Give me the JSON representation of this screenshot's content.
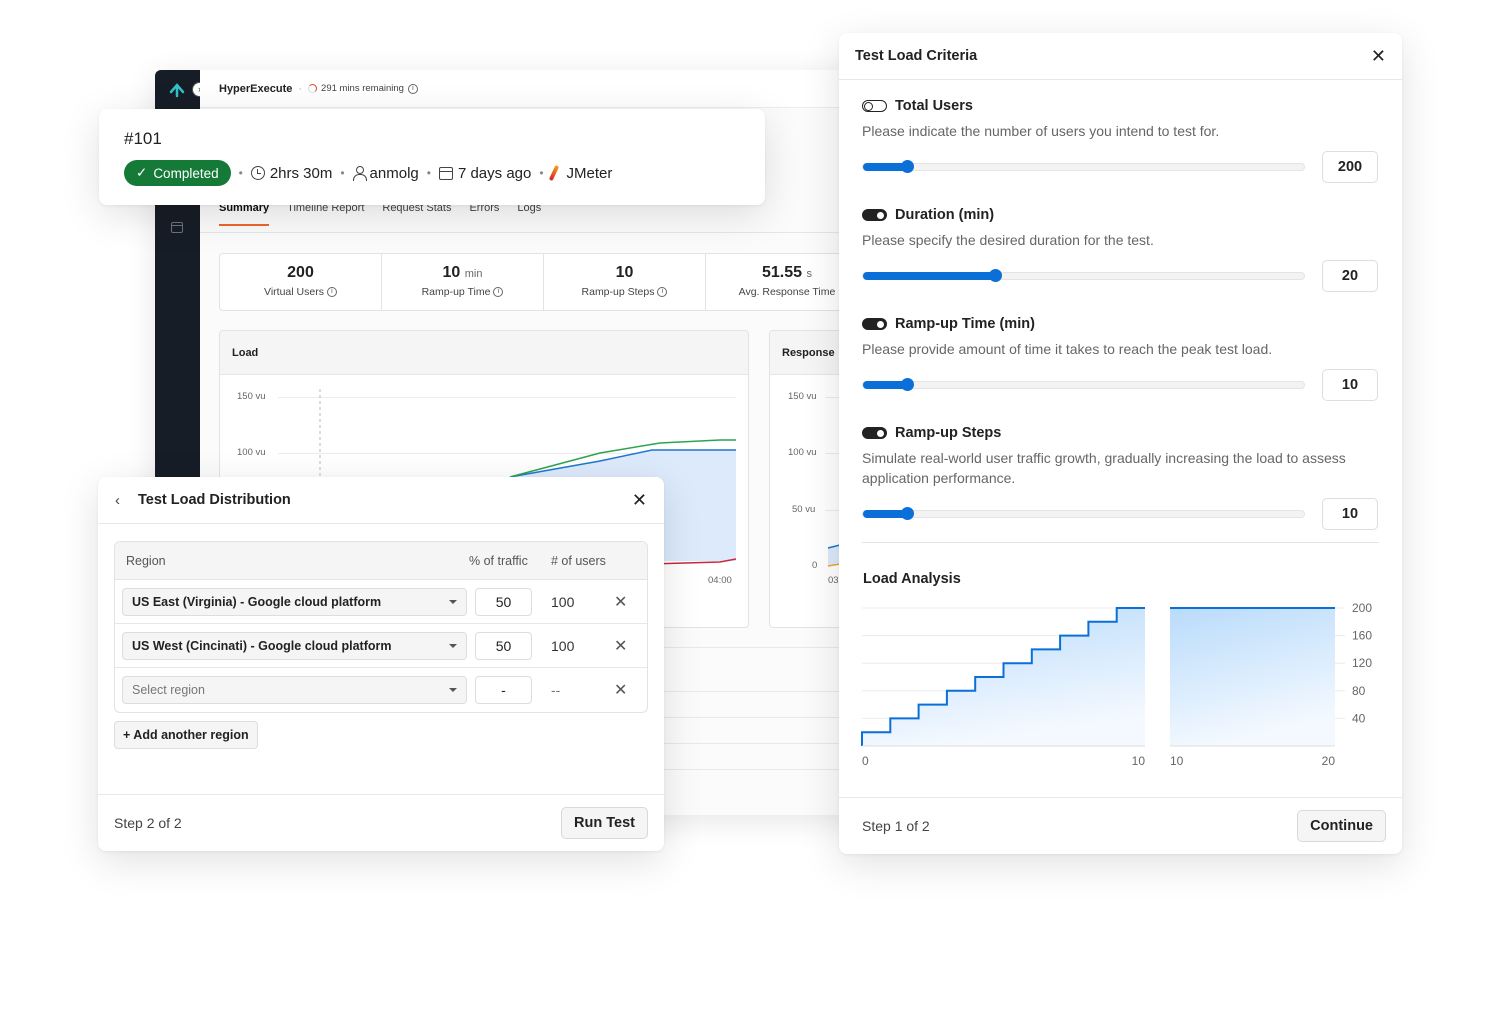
{
  "app": {
    "product": "HyperExecute",
    "separator": "·",
    "remaining": "291 mins remaining",
    "tabs": [
      {
        "label": "Summary",
        "active": true
      },
      {
        "label": "Timeline Report",
        "active": false
      },
      {
        "label": "Request Stats",
        "active": false
      },
      {
        "label": "Errors",
        "active": false
      },
      {
        "label": "Logs",
        "active": false
      }
    ],
    "stats": [
      {
        "value": "200",
        "unit": "",
        "label": "Virtual Users"
      },
      {
        "value": "10",
        "unit": "min",
        "label": "Ramp-up Time"
      },
      {
        "value": "10",
        "unit": "",
        "label": "Ramp-up Steps"
      },
      {
        "value": "51.55",
        "unit": "s",
        "label": "Avg. Response Time"
      }
    ],
    "load_chart": {
      "title": "Load",
      "yticks": [
        "150 vu",
        "100 vu"
      ],
      "x_tick_visible": "04:00",
      "series_colors": {
        "total": "#2ea44f",
        "active": "#1f77d0",
        "errors": "#c62a3c"
      }
    },
    "response_chart": {
      "title": "Response",
      "yticks": [
        "150 vu",
        "100 vu",
        "50 vu",
        "0"
      ],
      "x_tick_visible": "03"
    }
  },
  "job": {
    "id": "#101",
    "status": "Completed",
    "duration": "2hrs 30m",
    "user": "anmolg",
    "when": "7 days ago",
    "tool": "JMeter"
  },
  "distribution": {
    "title": "Test Load Distribution",
    "columns": {
      "region": "Region",
      "traffic": "% of traffic",
      "users": "# of users"
    },
    "rows": [
      {
        "region": "US East (Virginia) - Google cloud platform",
        "traffic": "50",
        "users": "100",
        "placeholder": false
      },
      {
        "region": "US West (Cincinati) - Google cloud platform",
        "traffic": "50",
        "users": "100",
        "placeholder": false
      },
      {
        "region": "Select region",
        "traffic": "-",
        "users": "--",
        "placeholder": true
      }
    ],
    "add_label": "+ Add another region",
    "step": "Step 2 of 2",
    "action": "Run Test"
  },
  "criteria": {
    "title": "Test Load Criteria",
    "sections": [
      {
        "title": "Total Users",
        "enabled": false,
        "desc": "Please indicate the number of users you intend to test for.",
        "value": "200",
        "slider_fraction": 0.1
      },
      {
        "title": "Duration (min)",
        "enabled": true,
        "desc": "Please specify the desired duration for the test.",
        "value": "20",
        "slider_fraction": 0.3
      },
      {
        "title": "Ramp-up Time (min)",
        "enabled": true,
        "desc": "Please provide amount of time it takes to reach the peak test load.",
        "value": "10",
        "slider_fraction": 0.1
      },
      {
        "title": "Ramp-up Steps",
        "enabled": true,
        "desc": "Simulate real-world user traffic growth, gradually increasing the load to assess application performance.",
        "value": "10",
        "slider_fraction": 0.1
      }
    ],
    "analysis_title": "Load Analysis",
    "step": "Step 1 of 2",
    "action": "Continue"
  },
  "chart_data": {
    "type": "area",
    "title": "Load Analysis",
    "xlabel": "",
    "ylabel": "",
    "line_color": "#0b6fd8",
    "ylim": [
      0,
      200
    ],
    "yticks": [
      40,
      80,
      120,
      160,
      200
    ],
    "panels": [
      {
        "name": "ramp-up",
        "xlim": [
          0,
          10
        ],
        "xticks": [
          0,
          10
        ],
        "step": true,
        "x": [
          0,
          1,
          2,
          3,
          4,
          5,
          6,
          7,
          8,
          9,
          10
        ],
        "y": [
          20,
          40,
          60,
          80,
          100,
          120,
          140,
          160,
          180,
          200,
          200
        ]
      },
      {
        "name": "steady",
        "xlim": [
          10,
          20
        ],
        "xticks": [
          10,
          20
        ],
        "step": false,
        "x": [
          10,
          20
        ],
        "y": [
          200,
          200
        ]
      }
    ],
    "grid": true
  }
}
